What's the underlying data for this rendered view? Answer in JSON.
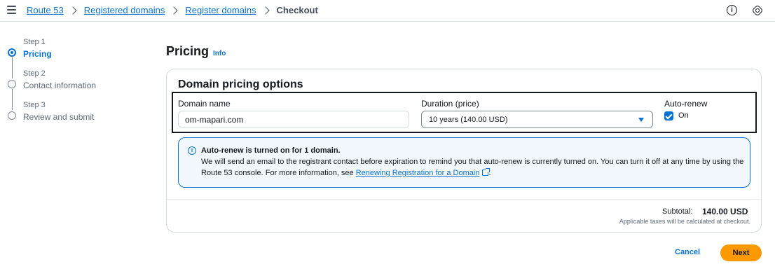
{
  "header": {
    "breadcrumbs": [
      {
        "label": "Route 53"
      },
      {
        "label": "Registered domains"
      },
      {
        "label": "Register domains"
      }
    ],
    "current": "Checkout",
    "info_icon": "info-icon",
    "settings_icon": "settings-icon"
  },
  "steps": [
    {
      "sub": "Step 1",
      "label": "Pricing",
      "active": true
    },
    {
      "sub": "Step 2",
      "label": "Contact information",
      "active": false
    },
    {
      "sub": "Step 3",
      "label": "Review and submit",
      "active": false
    }
  ],
  "page": {
    "title": "Pricing",
    "info_link": "Info"
  },
  "pricing": {
    "title": "Domain pricing options",
    "domain_label": "Domain name",
    "domain_value": "om-mapari.com",
    "duration_label": "Duration (price)",
    "duration_value": "10 years (140.00 USD)",
    "autorenew_label": "Auto-renew",
    "autorenew_option": "On",
    "autorenew_checked": true
  },
  "alert": {
    "title": "Auto-renew is turned on for 1 domain.",
    "body": "We will send an email to the registrant contact before expiration to remind you that auto-renew is currently turned on. You can turn it off at any time by using the Route 53 console. For more information, see ",
    "link": "Renewing Registration for a Domain",
    "end": "."
  },
  "summary": {
    "subtotal_label": "Subtotal:",
    "subtotal_value": "140.00 USD",
    "tax_note": "Applicable taxes will be calculated at checkout."
  },
  "actions": {
    "cancel": "Cancel",
    "next": "Next"
  },
  "colors": {
    "accent": "#0972d3",
    "primary_button": "#ff9900",
    "alert_bg": "#f2f8fd"
  }
}
